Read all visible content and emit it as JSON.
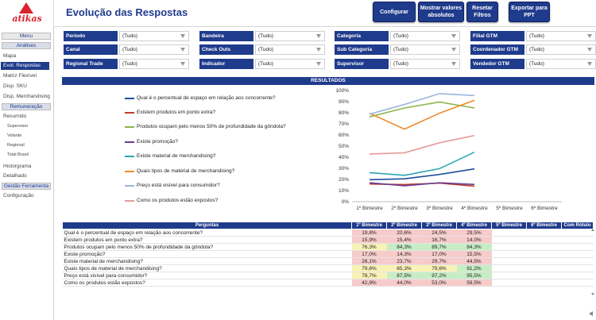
{
  "app": {
    "logo_text": "atikas",
    "title": "Evolução das Respostas"
  },
  "toolbar": {
    "configurar": "Configurar",
    "mostrar_l1": "Mostrar valores",
    "mostrar_l2": "absolutos",
    "resetar_l1": "Resetar",
    "resetar_l2": "Filtros",
    "exportar_l1": "Exportar para",
    "exportar_l2": "PPT"
  },
  "sidebar": {
    "menu": "Menu",
    "analises": "Análises",
    "mapa": "Mapa",
    "evol": "Evol. Respostas",
    "matriz": "Matriz Flexível",
    "disp_sku": "Disp. SKU",
    "disp_merch": "Disp. Merchandising",
    "remuneracao": "Remuneração",
    "resumido": "Resumido",
    "supervisor": "Supervisor",
    "volante": "Volante",
    "regional": "Regional",
    "total_brasil": "Total Brasil",
    "historgrama": "Historgrama",
    "detalhado": "Detalhado",
    "gestao": "Gestão Ferramenta",
    "configuracao": "Configuração"
  },
  "filters": [
    {
      "label": "Período",
      "value": "(Tudo)"
    },
    {
      "label": "Bandeira",
      "value": "(Tudo)"
    },
    {
      "label": "Categoria",
      "value": "(Tudo)"
    },
    {
      "label": "Filial GTM",
      "value": "(Tudo)"
    },
    {
      "label": "Canal",
      "value": "(Tudo)"
    },
    {
      "label": "Check Outs",
      "value": "(Tudo)"
    },
    {
      "label": "Sub Categoria",
      "value": "(Tudo)"
    },
    {
      "label": "Coordenador GTM",
      "value": "(Tudo)"
    },
    {
      "label": "Regional Trade",
      "value": "(Tudo)"
    },
    {
      "label": "Indicador",
      "value": "(Tudo)"
    },
    {
      "label": "Supervisor",
      "value": "(Tudo)"
    },
    {
      "label": "Vendedor GTM",
      "value": "(Tudo)"
    }
  ],
  "results_title": "RESULTADOS",
  "chart_data": {
    "type": "line",
    "categories": [
      "1º Bimestre",
      "2º Bimestre",
      "3º Bimestre",
      "4º Bimestre",
      "5º Bimestre",
      "6º Bimestre"
    ],
    "ylim": [
      0,
      100
    ],
    "yticks": [
      "0%",
      "10%",
      "20%",
      "30%",
      "40%",
      "50%",
      "60%",
      "70%",
      "80%",
      "90%",
      "100%"
    ],
    "series": [
      {
        "name": "Qual é o percentual de espaço em relação aos concorrente?",
        "color": "#1f4e9c",
        "values": [
          19.8,
          20.6,
          24.5,
          29.5
        ]
      },
      {
        "name": "Existem produtos em ponto extra?",
        "color": "#c0392b",
        "values": [
          15.9,
          15.4,
          16.7,
          14.0
        ]
      },
      {
        "name": "Produtos ocupam pelo menos 50% de profundidade da gôndola?",
        "color": "#8db54a",
        "values": [
          76.3,
          84.3,
          89.7,
          84.3
        ]
      },
      {
        "name": "Existe promoção?",
        "color": "#6a3d8f",
        "values": [
          17.0,
          14.3,
          17.0,
          15.5
        ]
      },
      {
        "name": "Existe material de merchandising?",
        "color": "#2aa6b4",
        "values": [
          26.1,
          23.7,
          29.7,
          44.5
        ]
      },
      {
        "name": "Quais tipos de material de merchandising?",
        "color": "#ee8a2a",
        "values": [
          79.6,
          65.3,
          79.6,
          91.2
        ]
      },
      {
        "name": "Preço está visível para consumidor?",
        "color": "#9db4df",
        "values": [
          78.7,
          87.5,
          97.2,
          95.5
        ]
      },
      {
        "name": "Como os produtos estão expostos?",
        "color": "#e79a9a",
        "values": [
          42.9,
          44.0,
          53.0,
          59.5
        ]
      }
    ]
  },
  "table": {
    "headers": [
      "Perguntas",
      "1º Bimestre",
      "2º Bimestre",
      "3º Bimestre",
      "4º Bimestre",
      "5º Bimestre",
      "6º Bimestre",
      "Com Rótulo"
    ],
    "rows": [
      {
        "q": "Qual é o percentual de espaço em relação aos concorrente?",
        "v": [
          "19,8%",
          "20,6%",
          "24,5%",
          "29,5%"
        ],
        "c": [
          "red",
          "red",
          "red",
          "red"
        ]
      },
      {
        "q": "Existem produtos em ponto extra?",
        "v": [
          "15,9%",
          "15,4%",
          "16,7%",
          "14,0%"
        ],
        "c": [
          "red",
          "red",
          "red",
          "red"
        ]
      },
      {
        "q": "Produtos ocupam pelo menos 50% de profundidade da gôndola?",
        "v": [
          "76,3%",
          "84,3%",
          "89,7%",
          "84,3%"
        ],
        "c": [
          "yel",
          "grn",
          "grn",
          "grn"
        ]
      },
      {
        "q": "Existe promoção?",
        "v": [
          "17,0%",
          "14,3%",
          "17,0%",
          "15,5%"
        ],
        "c": [
          "red",
          "red",
          "red",
          "red"
        ]
      },
      {
        "q": "Existe material de merchandising?",
        "v": [
          "26,1%",
          "23,7%",
          "29,7%",
          "44,5%"
        ],
        "c": [
          "red",
          "red",
          "red",
          "red"
        ]
      },
      {
        "q": "Quais tipos de material de merchandising?",
        "v": [
          "79,6%",
          "65,3%",
          "79,6%",
          "91,2%"
        ],
        "c": [
          "yel",
          "yel",
          "yel",
          "grn"
        ]
      },
      {
        "q": "Preço está visível para consumidor?",
        "v": [
          "78,7%",
          "87,5%",
          "97,2%",
          "95,5%"
        ],
        "c": [
          "yel",
          "grn",
          "grn",
          "grn"
        ]
      },
      {
        "q": "Como os produtos estão expostos?",
        "v": [
          "42,9%",
          "44,0%",
          "53,0%",
          "59,5%"
        ],
        "c": [
          "red",
          "red",
          "red",
          "red"
        ]
      }
    ]
  }
}
